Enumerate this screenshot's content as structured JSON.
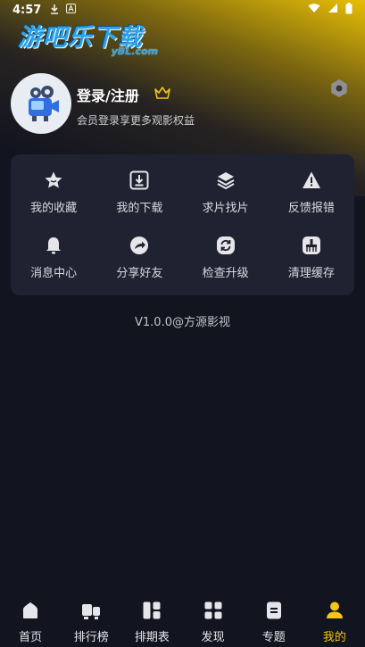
{
  "status_bar": {
    "time": "4:57"
  },
  "watermark": {
    "main": "游吧乐下载",
    "sub": "yBL.com"
  },
  "profile": {
    "login_label": "登录/注册",
    "subtitle": "会员登录享更多观影权益"
  },
  "menu": [
    {
      "label": "我的收藏",
      "icon": "star-icon"
    },
    {
      "label": "我的下载",
      "icon": "download-icon"
    },
    {
      "label": "求片找片",
      "icon": "layers-icon"
    },
    {
      "label": "反馈报错",
      "icon": "warning-icon"
    },
    {
      "label": "消息中心",
      "icon": "bell-icon"
    },
    {
      "label": "分享好友",
      "icon": "share-icon"
    },
    {
      "label": "检查升级",
      "icon": "refresh-icon"
    },
    {
      "label": "清理缓存",
      "icon": "broom-icon"
    }
  ],
  "version": "V1.0.0@方源影视",
  "bottom_nav": [
    {
      "label": "首页",
      "icon": "home-icon"
    },
    {
      "label": "排行榜",
      "icon": "ranking-icon"
    },
    {
      "label": "排期表",
      "icon": "schedule-icon"
    },
    {
      "label": "发现",
      "icon": "discover-icon"
    },
    {
      "label": "专题",
      "icon": "topic-icon"
    },
    {
      "label": "我的",
      "icon": "profile-icon",
      "active": true
    }
  ],
  "colors": {
    "accent": "#f5c518",
    "card": "#1f2230",
    "background": "#12141f"
  }
}
